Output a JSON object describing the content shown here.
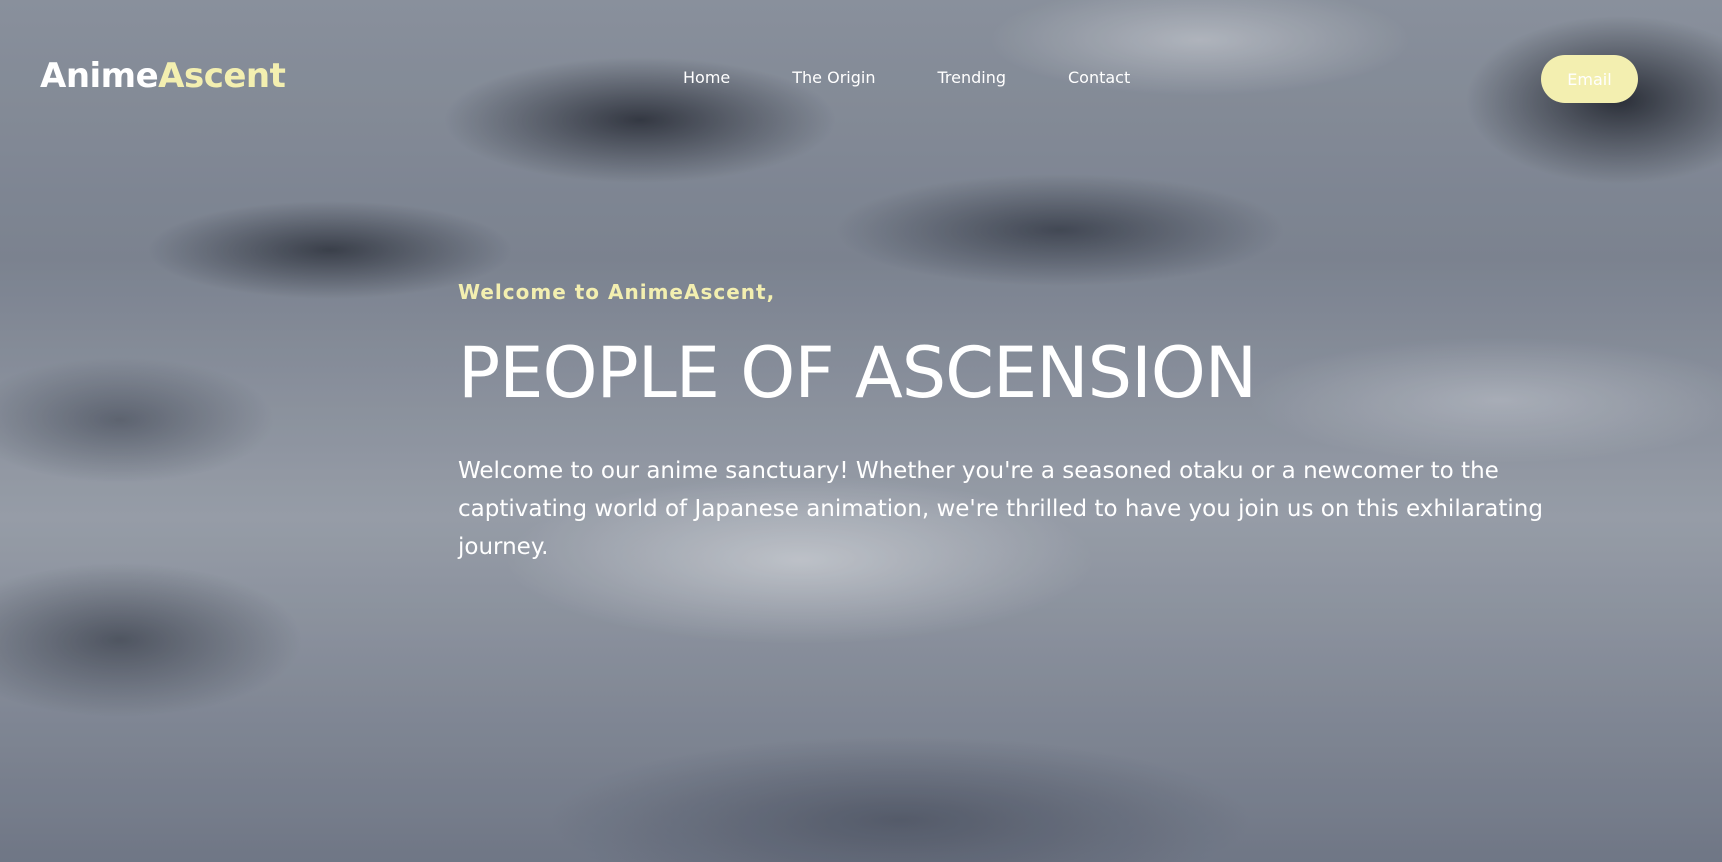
{
  "brand": {
    "name_part_a": "Anime",
    "name_part_b": "Ascent",
    "accent_color": "#f3efb0"
  },
  "nav": {
    "items": [
      {
        "label": "Home"
      },
      {
        "label": "The Origin"
      },
      {
        "label": "Trending"
      },
      {
        "label": "Contact"
      }
    ],
    "cta_label": "Email"
  },
  "hero": {
    "kicker": "Welcome to AnimeAscent,",
    "title": "PEOPLE OF ASCENSION",
    "description": "Welcome to our anime sanctuary! Whether you're a seasoned otaku or a newcomer to the captivating world of Japanese animation, we're thrilled to have you join us on this exhilarating journey.",
    "background": "stormy-cloud-sky-image"
  }
}
